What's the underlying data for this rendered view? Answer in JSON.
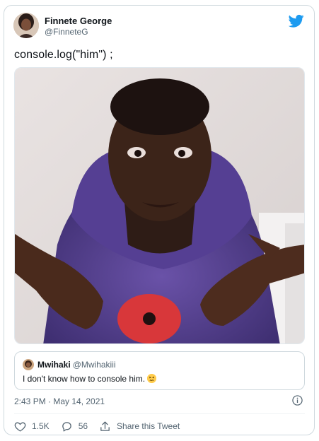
{
  "tweet": {
    "author_name": "Finnete George",
    "author_handle": "@FinneteG",
    "text": "console.log(\"him\") ;",
    "timestamp": "2:43 PM · May 14, 2021",
    "likes": "1.5K",
    "replies": "56",
    "share_label": "Share this Tweet",
    "brand_color": "#1d9bf0",
    "like_color": "#f91880"
  },
  "quoted_tweet": {
    "author_name": "Mwihaki",
    "author_handle": "@Mwihakiii",
    "text": "I don't know how to console him.",
    "emoji": "confounded-face"
  },
  "icons": {
    "logo": "twitter-bird-icon",
    "info": "info-icon",
    "like": "heart-icon",
    "reply": "reply-icon",
    "share": "share-icon"
  }
}
